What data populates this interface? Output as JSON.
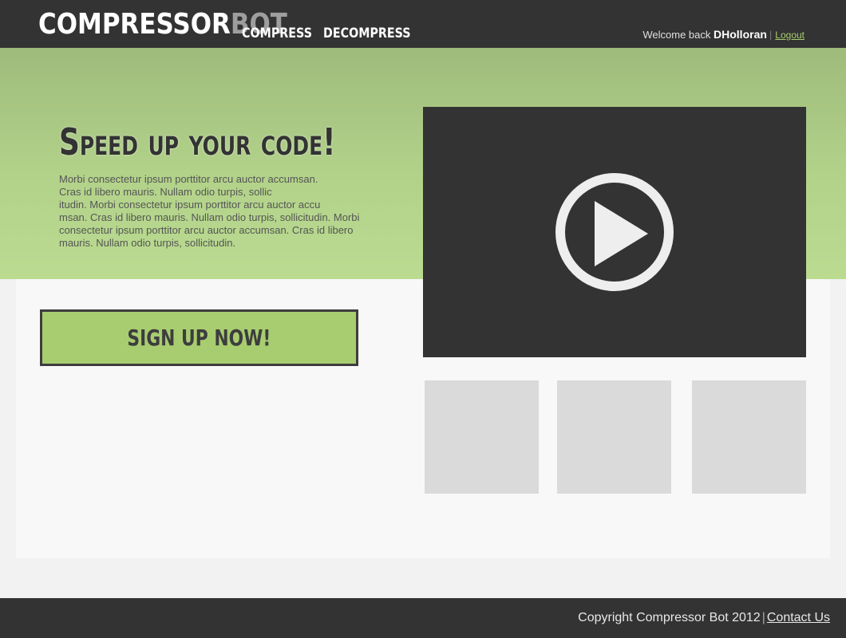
{
  "header": {
    "logo_part1": "Compressor",
    "logo_part2": "Bot",
    "nav": [
      {
        "label": "COMPRESS"
      },
      {
        "label": "DECOMPRESS"
      }
    ],
    "welcome_text": "Welcome back",
    "username": "DHolloran",
    "separator": "|",
    "logout_label": "Logout"
  },
  "hero": {
    "headline": "Speed up your code!",
    "intro_lines": [
      "Morbi consectetur ipsum porttitor arcu auctor accumsan.",
      "Cras id libero mauris. Nullam odio turpis, sollic",
      "itudin. Morbi consectetur ipsum porttitor arcu auctor accu",
      "msan. Cras id libero mauris. Nullam odio turpis, sollicitudin. Morbi",
      "consectetur ipsum porttitor arcu auctor accumsan. Cras id libero",
      "mauris. Nullam odio turpis, sollicitudin."
    ],
    "signup_label": "SIGN UP NOW!"
  },
  "video": {
    "icon": "play-icon"
  },
  "footer": {
    "copyright": "Copyright Compressor Bot 2012",
    "separator": "|",
    "contact_label": "Contact Us"
  },
  "colors": {
    "header_bg": "#333333",
    "hero_green": "#b2d28a",
    "button_green": "#a8cd70",
    "logout_link": "#a6cc6e",
    "thumb_gray": "#dadada"
  }
}
